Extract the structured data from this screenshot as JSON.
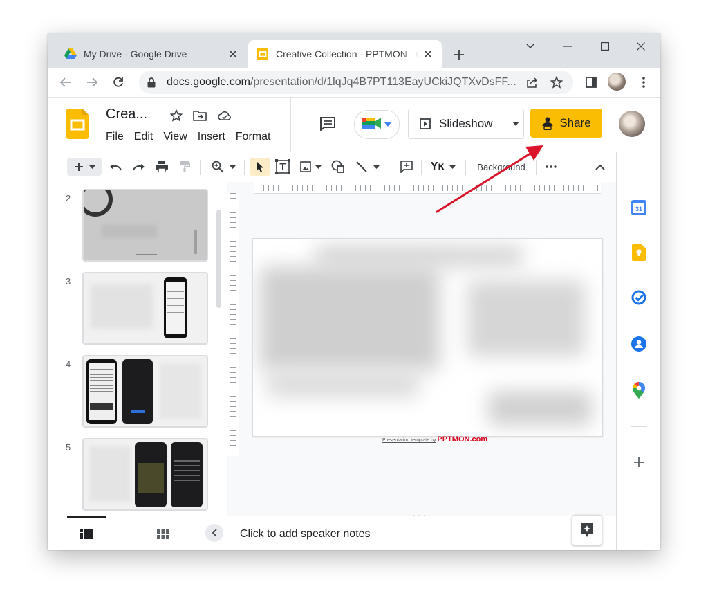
{
  "browser": {
    "tabs": [
      {
        "title": "My Drive - Google Drive",
        "favicon": "google-drive-icon",
        "active": false
      },
      {
        "title": "Creative Collection - PPTMON - Google Slides",
        "favicon": "google-slides-icon",
        "active": true
      }
    ],
    "url": {
      "host": "docs.google.com",
      "path": "/presentation/d/1lqJq4B7PT113EayUCkiJQTXvDsFF..."
    }
  },
  "app": {
    "doc_title": "Crea...",
    "menus": [
      "File",
      "Edit",
      "View",
      "Insert",
      "Format"
    ],
    "slideshow_label": "Slideshow",
    "share_label": "Share",
    "share_color": "#fbbc04"
  },
  "toolbar": {
    "background_label": "Background"
  },
  "filmstrip": {
    "slides": [
      {
        "number": "2"
      },
      {
        "number": "3"
      },
      {
        "number": "4"
      },
      {
        "number": "5"
      }
    ]
  },
  "canvas": {
    "footer_text": "Presentation template by",
    "footer_brand": "PPTMON.com"
  },
  "notes": {
    "placeholder": "Click to add speaker notes"
  },
  "annotation": {
    "arrow_color": "#d9142b"
  }
}
